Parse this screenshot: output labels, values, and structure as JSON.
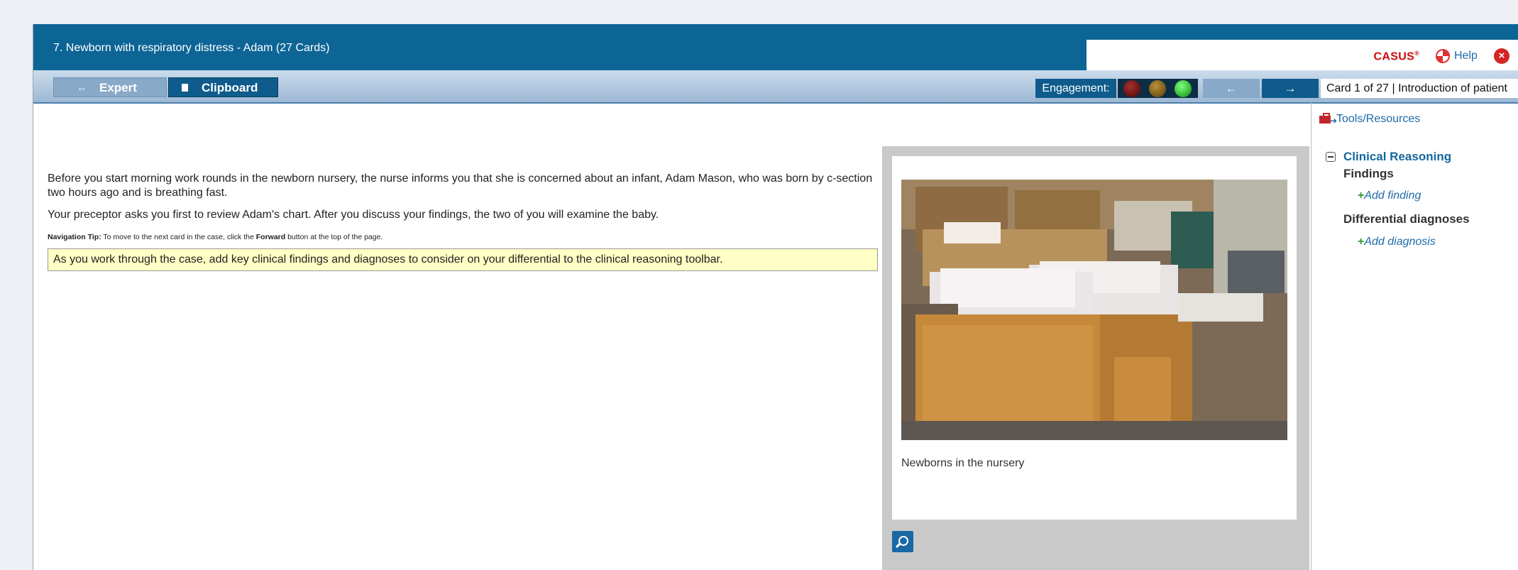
{
  "header": {
    "title": "7. Newborn with respiratory distress - Adam (27 Cards)",
    "brand": "CASUS",
    "brand_mark": "®",
    "help_label": "Help"
  },
  "toolbar": {
    "expert_label": "Expert",
    "clipboard_label": "Clipboard",
    "engagement_label": "Engagement:",
    "back_label": "←",
    "forward_label": "→",
    "card_info": "Card 1 of 27 | Introduction of patient"
  },
  "card": {
    "intro": "Before you start morning work rounds in the newborn nursery, the nurse informs you that she is concerned about an infant, Adam Mason, who was born by c-section two hours ago and is breathing fast.",
    "preceptor": "Your preceptor asks you first to review Adam's chart. After you discuss your findings, the two of you will examine the baby.",
    "tip_label": "Navigation Tip:",
    "tip_text_1": " To move to the next card in the case, click the ",
    "tip_forward": "Forward",
    "tip_text_2": " button at the top of the page.",
    "note": "As you work through the case, add key clinical findings and diagnoses to consider on your differential to the clinical reasoning toolbar."
  },
  "media": {
    "caption": "Newborns in the nursery"
  },
  "sidebar": {
    "tools_label": "Tools/Resources",
    "clinical_reasoning": "Clinical Reasoning",
    "findings": "Findings",
    "add_finding": "Add finding",
    "differential": "Differential diagnoses",
    "add_diagnosis": "Add diagnosis"
  },
  "icons": [
    "help-icon",
    "close-icon",
    "expert-icon",
    "clipboard-icon",
    "tools-icon",
    "collapse-icon",
    "zoom-icon"
  ],
  "colors": {
    "titlebar": "#0d6596",
    "brand": "#cc0d0d",
    "link": "#1e6aa8",
    "note_bg": "#ffffc6"
  }
}
